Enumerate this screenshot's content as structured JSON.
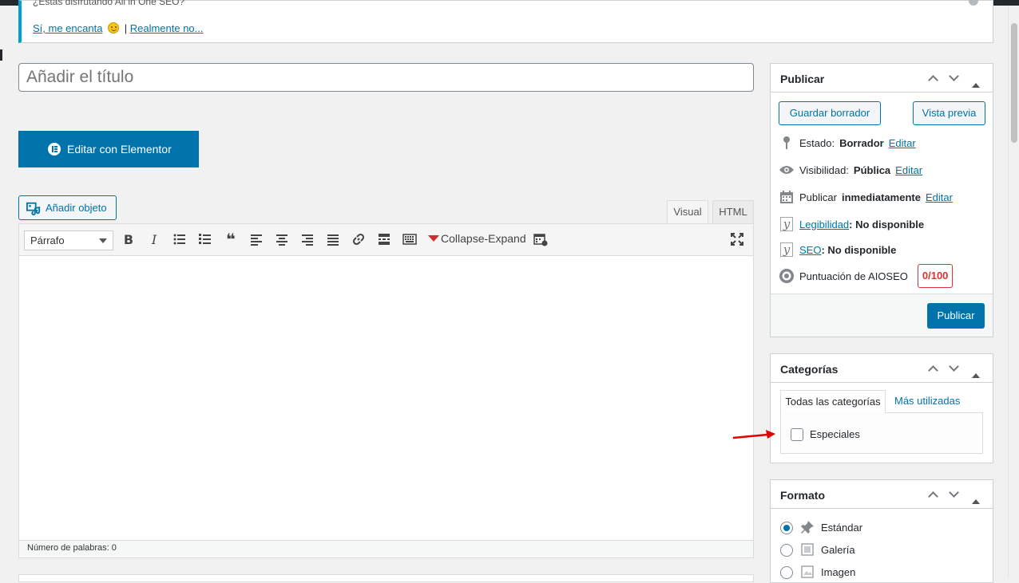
{
  "notice": {
    "cut_text": "¿Estás disfrutando All in One SEO?",
    "yes_link": "Sí, me encanta",
    "separator": "|",
    "no_link": "Realmente no..."
  },
  "title": {
    "placeholder": "Añadir el título"
  },
  "elementor": {
    "label": "Editar con Elementor"
  },
  "media": {
    "label": "Añadir objeto"
  },
  "editor": {
    "tabs": [
      "Visual",
      "HTML"
    ],
    "active_tab": "Visual",
    "format_value": "Párrafo",
    "collapse_label": "Collapse-Expand",
    "word_count": "Número de palabras: 0"
  },
  "publish": {
    "title": "Publicar",
    "save_draft": "Guardar borrador",
    "preview": "Vista previa",
    "status_label": "Estado:",
    "status_value": "Borrador",
    "visibility_label": "Visibilidad:",
    "visibility_value": "Pública",
    "schedule_label": "Publicar",
    "schedule_value": "inmediatamente",
    "edit": "Editar",
    "readability_link": "Legibilidad",
    "readability_value": ": No disponible",
    "seo_link": "SEO",
    "seo_value": ": No disponible",
    "aioseo_label": "Puntuación de AIOSEO",
    "aioseo_score": "0/100",
    "publish_button": "Publicar"
  },
  "categories": {
    "title": "Categorías",
    "tab_all": "Todas las categorías",
    "tab_used": "Más utilizadas",
    "items": [
      {
        "label": "Especiales",
        "checked": false
      }
    ]
  },
  "format": {
    "title": "Formato",
    "options": [
      {
        "label": "Estándar",
        "selected": true
      },
      {
        "label": "Galería",
        "selected": false
      },
      {
        "label": "Imagen",
        "selected": false
      }
    ]
  },
  "colors": {
    "accent": "#0073aa",
    "notice_border": "#00a0d2",
    "score": "#dc3232",
    "arrow": "#e00000"
  }
}
